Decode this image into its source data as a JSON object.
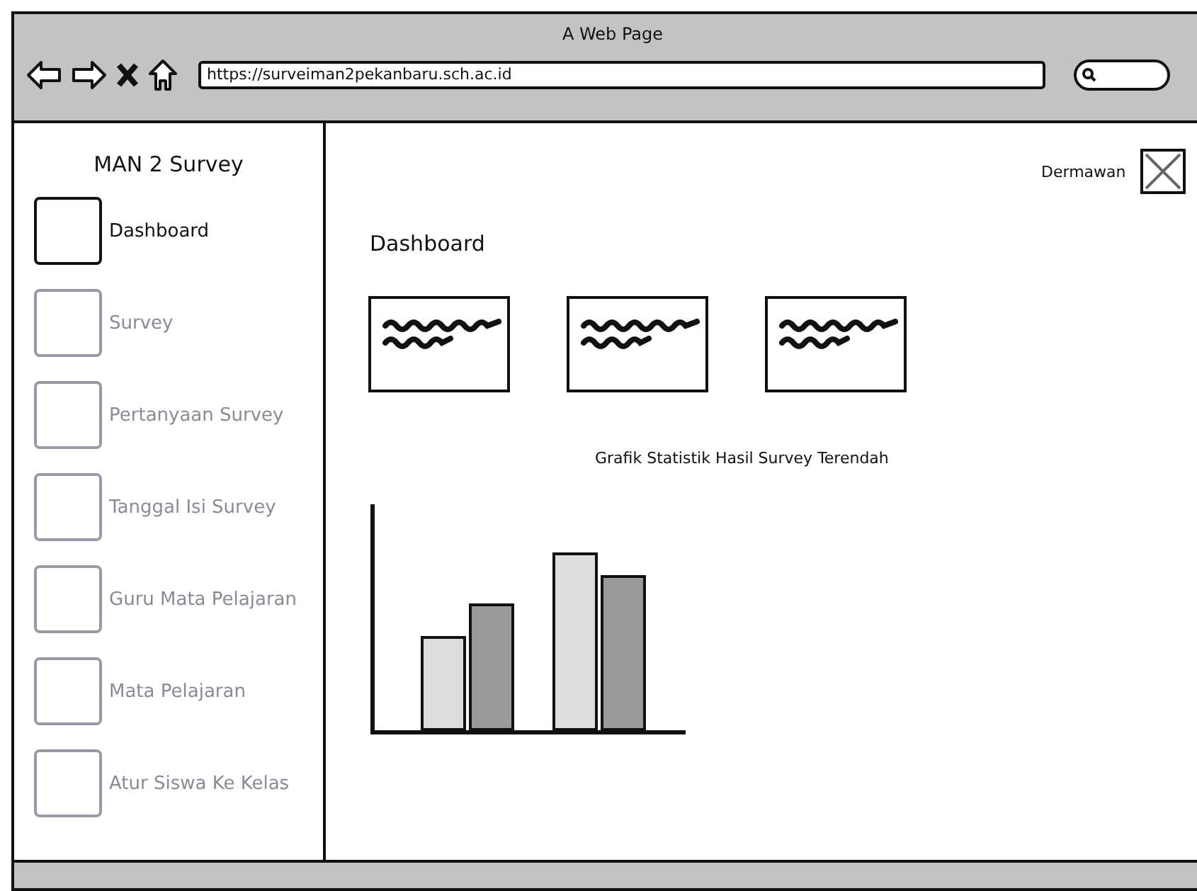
{
  "window": {
    "title": "A Web Page"
  },
  "browser": {
    "url": "https://surveiman2pekanbaru.sch.ac.id"
  },
  "sidebar": {
    "title": "MAN 2 Survey",
    "items": [
      {
        "label": "Dashboard",
        "selected": true
      },
      {
        "label": "Survey",
        "selected": false
      },
      {
        "label": "Pertanyaan Survey",
        "selected": false
      },
      {
        "label": "Tanggal Isi Survey",
        "selected": false
      },
      {
        "label": "Guru Mata Pelajaran",
        "selected": false
      },
      {
        "label": "Mata Pelajaran",
        "selected": false
      },
      {
        "label": "Atur Siswa Ke Kelas",
        "selected": false
      }
    ]
  },
  "user": {
    "name": "Dermawan"
  },
  "page": {
    "heading": "Dashboard",
    "cards": [
      {
        "kind": "scribble"
      },
      {
        "kind": "scribble"
      },
      {
        "kind": "scribble"
      }
    ],
    "chart": {
      "title": "Grafik Statistik Hasil Survey Terendah"
    }
  }
}
